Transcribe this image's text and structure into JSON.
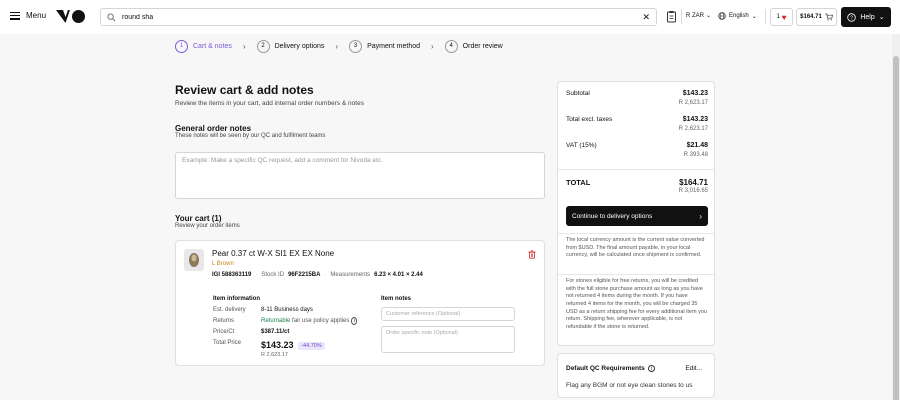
{
  "header": {
    "menu_label": "Menu",
    "search_value": "round sha",
    "currency": "R ZAR",
    "language": "English",
    "saved_count": "1",
    "cart_total": "$164.71",
    "help_label": "Help"
  },
  "stepper": {
    "steps": [
      {
        "num": "1",
        "label": "Cart & notes"
      },
      {
        "num": "2",
        "label": "Delivery options"
      },
      {
        "num": "3",
        "label": "Payment method"
      },
      {
        "num": "4",
        "label": "Order review"
      }
    ]
  },
  "main": {
    "title": "Review cart & add notes",
    "subtitle": "Review the items in your cart, add internal order numbers & notes",
    "general_notes_title": "General order notes",
    "general_notes_sub": "These notes will be seen by our QC and fulfilment teams",
    "general_notes_placeholder": "Example: Make a specific QC request, add a comment for Nivoda etc.",
    "cart_title": "Your cart (1)",
    "cart_sub": "Review your order items"
  },
  "item": {
    "name": "Pear 0.37 ct W-X SI1 EX EX None",
    "color_label": "L Brown",
    "igi_label": "IGI 588363119",
    "stock_label": "Stock ID",
    "stock_id": "96F2215BA",
    "measurements_label": "Measurements",
    "measurements": "6.23 × 4.01 × 2.44",
    "info_title": "Item information",
    "notes_title": "Item notes",
    "delivery_label": "Est. delivery",
    "delivery_value": "8-11 Business days",
    "returns_label": "Returns",
    "returns_value": "Returnable",
    "returns_policy": "fair use policy applies",
    "price_ct_label": "Price/Ct",
    "price_ct_value": "$387.11/ct",
    "total_label": "Total Price",
    "total_value": "$143.23",
    "discount": "-44.70%",
    "total_zar": "R 2,623.17",
    "ref_placeholder": "Customer reference (Optional)",
    "note_placeholder": "Order specific note (Optional)"
  },
  "summary": {
    "subtotal_label": "Subtotal",
    "subtotal_usd": "$143.23",
    "subtotal_zar": "R 2,623.17",
    "excl_label": "Total excl. taxes",
    "excl_usd": "$143.23",
    "excl_zar": "R 2,623.17",
    "vat_label": "VAT (15%)",
    "vat_usd": "$21.48",
    "vat_zar": "R 393.48",
    "total_label": "TOTAL",
    "total_usd": "$164.71",
    "total_zar": "R 3,016.65",
    "continue_label": "Continue to delivery options",
    "currency_note": "The local currency amount is the current value converted from $USD. The final amount payable, in your local currency, will be calculated once shipment is confirmed.",
    "returns_note": "For stones eligible for free returns, you will be credited with the full stone purchase amount as long as you have not returned 4 items during the month. If you have returned 4 items for the month, you will be charged 35 USD as a return shipping fee for every additional item you return. Shipping fee, wherever applicable, is not refundable if the stone is returned."
  },
  "qc": {
    "title": "Default QC Requirements",
    "edit_label": "Edit...",
    "text": "Flag any BGM or not eye clean stones to us"
  }
}
